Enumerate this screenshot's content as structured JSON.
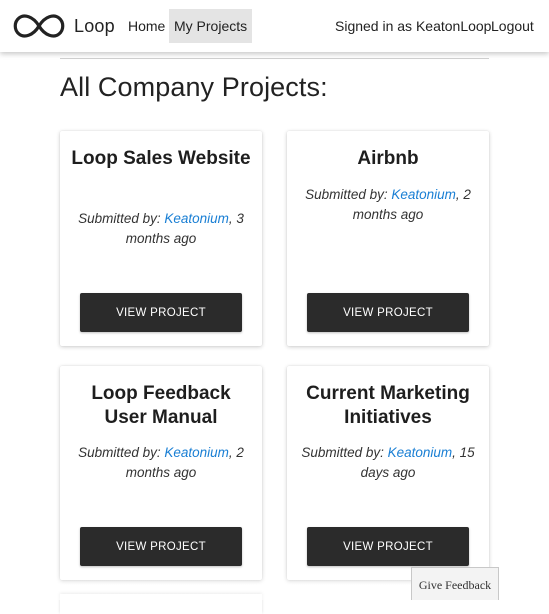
{
  "nav": {
    "brand": "Loop",
    "home": "Home",
    "my_projects": "My Projects",
    "signed_in": "Signed in as KeatonLoop",
    "logout": "Logout"
  },
  "page": {
    "heading": "All Company Projects:"
  },
  "projects": [
    {
      "title": "Loop Sales Website",
      "submitted_prefix": "Submitted by: ",
      "author": "Keatonium",
      "age": ", 3 months ago",
      "button": "VIEW PROJECT"
    },
    {
      "title": "Airbnb",
      "submitted_prefix": "Submitted by: ",
      "author": "Keatonium",
      "age": ", 2 months ago",
      "button": "VIEW PROJECT"
    },
    {
      "title": "Loop Feedback User Manual",
      "submitted_prefix": "Submitted by: ",
      "author": "Keatonium",
      "age": ", 2 months ago",
      "button": "VIEW PROJECT"
    },
    {
      "title": "Current Marketing Initiatives",
      "submitted_prefix": "Submitted by: ",
      "author": "Keatonium",
      "age": ", 15 days ago",
      "button": "VIEW PROJECT"
    }
  ],
  "feedback": {
    "label": "Give Feedback"
  },
  "colors": {
    "link": "#1a7fd4",
    "button": "#2b2b2b",
    "active_nav": "#e4e4e4"
  },
  "icons": {
    "brand_logo": "infinity-loop-icon"
  }
}
